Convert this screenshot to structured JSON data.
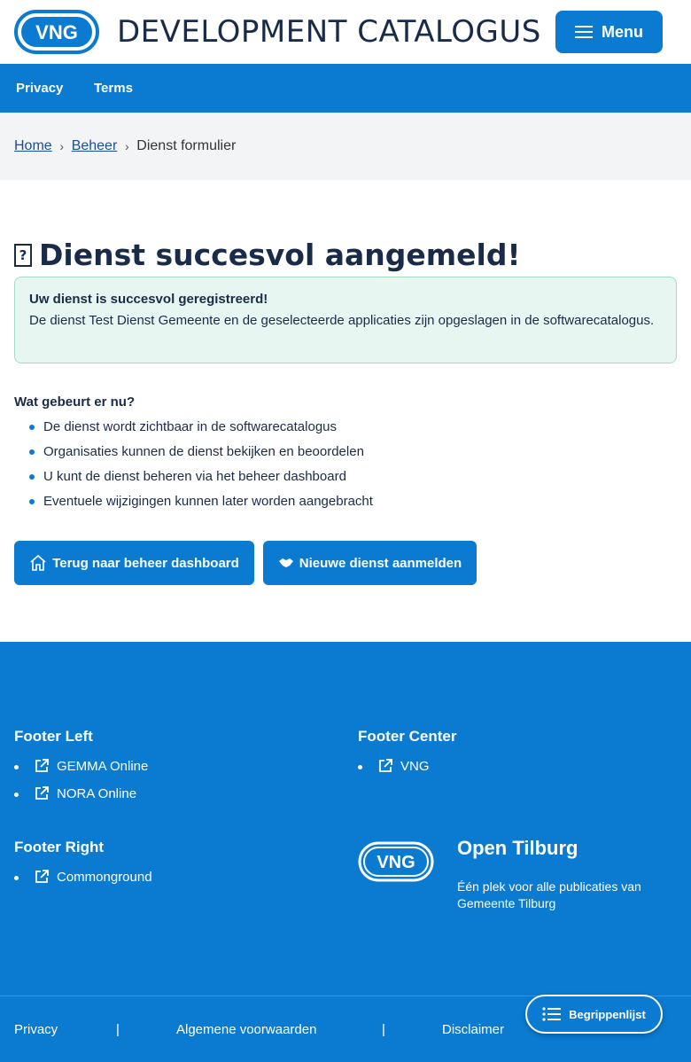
{
  "header": {
    "logo_text": "VNG",
    "site_title": "DEVELOPMENT CATALOGUS",
    "menu_label": "Menu"
  },
  "topnav": {
    "items": [
      {
        "label": "Privacy"
      },
      {
        "label": "Terms"
      }
    ]
  },
  "breadcrumb": {
    "items": [
      {
        "label": "Home"
      },
      {
        "label": "Beheer"
      }
    ],
    "current": "Dienst formulier"
  },
  "main": {
    "title": "Dienst succesvol aangemeld!",
    "alert": {
      "title": "Uw dienst is succesvol geregistreerd!",
      "text": "De dienst Test Dienst Gemeente en de geselecteerde applicaties zijn opgeslagen in de softwarecatalogus."
    },
    "next_heading": "Wat gebeurt er nu?",
    "next_steps": [
      "De dienst wordt zichtbaar in de softwarecatalogus",
      "Organisaties kunnen de dienst bekijken en beoordelen",
      "U kunt de dienst beheren via het beheer dashboard",
      "Eventuele wijzigingen kunnen later worden aangebracht"
    ],
    "buttons": {
      "dashboard": "Terug naar beheer dashboard",
      "new_service": "Nieuwe dienst aanmelden"
    }
  },
  "footer": {
    "left": {
      "heading": "Footer Left",
      "links": [
        "GEMMA Online",
        "NORA Online"
      ]
    },
    "center": {
      "heading": "Footer Center",
      "links": [
        "VNG"
      ]
    },
    "right": {
      "heading": "Footer Right",
      "links": [
        "Commonground"
      ]
    },
    "brand": {
      "logo_text": "VNG",
      "name": "Open Tilburg",
      "tagline": "Één plek voor alle publicaties van Gemeente Tilburg"
    },
    "bottom_links": [
      "Privacy",
      "Algemene voorwaarden",
      "Disclaimer"
    ],
    "separator": "|"
  },
  "glossary_button": "Begrippenlijst",
  "colors": {
    "primary": "#0a7bd1",
    "text": "#1a2b4a",
    "alert_bg": "#e8f6f1",
    "alert_border": "#a3dcc5",
    "breadcrumb_bg": "#f3f4f6"
  }
}
